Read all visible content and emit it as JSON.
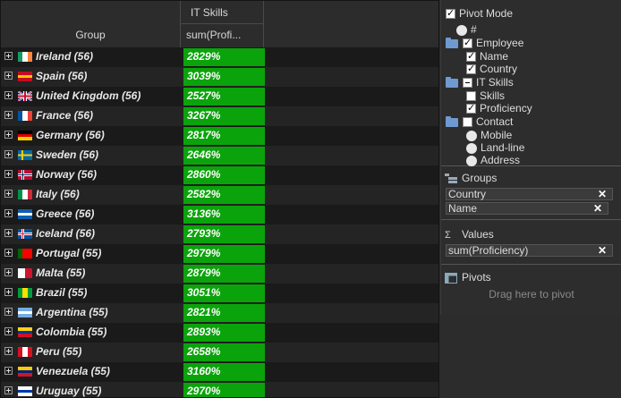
{
  "header": {
    "group_col": "Group",
    "itskills_col": "IT Skills",
    "sum_col": "sum(Profi..."
  },
  "rows": [
    {
      "label": "Ireland (56)",
      "value": "2829%",
      "flag": "ireland-flag-icon",
      "flag_colors": [
        "#169b62",
        "#ffffff",
        "#ff883e"
      ],
      "flag_dir": "v"
    },
    {
      "label": "Spain (56)",
      "value": "3039%",
      "flag": "spain-flag-icon",
      "flag_colors": [
        "#c60b1e",
        "#ffc400",
        "#c60b1e"
      ],
      "flag_dir": "h"
    },
    {
      "label": "United Kingdom (56)",
      "value": "2527%",
      "flag": "uk-flag-icon",
      "flag_colors": [
        "#012169",
        "#c8102e",
        "#ffffff"
      ],
      "flag_dir": "uk"
    },
    {
      "label": "France (56)",
      "value": "3267%",
      "flag": "france-flag-icon",
      "flag_colors": [
        "#0055a4",
        "#ffffff",
        "#ef4135"
      ],
      "flag_dir": "v"
    },
    {
      "label": "Germany (56)",
      "value": "2817%",
      "flag": "germany-flag-icon",
      "flag_colors": [
        "#000000",
        "#dd0000",
        "#ffce00"
      ],
      "flag_dir": "h"
    },
    {
      "label": "Sweden (56)",
      "value": "2646%",
      "flag": "sweden-flag-icon",
      "flag_colors": [
        "#006aa7",
        "#fecc00"
      ],
      "flag_dir": "nordic"
    },
    {
      "label": "Norway (56)",
      "value": "2860%",
      "flag": "norway-flag-icon",
      "flag_colors": [
        "#ba0c2f",
        "#00205b"
      ],
      "flag_dir": "nordic"
    },
    {
      "label": "Italy (56)",
      "value": "2582%",
      "flag": "italy-flag-icon",
      "flag_colors": [
        "#009246",
        "#ffffff",
        "#ce2b37"
      ],
      "flag_dir": "v"
    },
    {
      "label": "Greece (56)",
      "value": "3136%",
      "flag": "greece-flag-icon",
      "flag_colors": [
        "#0d5eaf",
        "#ffffff",
        "#0d5eaf"
      ],
      "flag_dir": "h"
    },
    {
      "label": "Iceland (56)",
      "value": "2793%",
      "flag": "iceland-flag-icon",
      "flag_colors": [
        "#02529c",
        "#dc1e35"
      ],
      "flag_dir": "nordic"
    },
    {
      "label": "Portugal (55)",
      "value": "2979%",
      "flag": "portugal-flag-icon",
      "flag_colors": [
        "#006600",
        "#ff0000",
        "#ff0000"
      ],
      "flag_dir": "v"
    },
    {
      "label": "Malta (55)",
      "value": "2879%",
      "flag": "malta-flag-icon",
      "flag_colors": [
        "#ffffff",
        "#cf142b"
      ],
      "flag_dir": "v"
    },
    {
      "label": "Brazil (55)",
      "value": "3051%",
      "flag": "brazil-flag-icon",
      "flag_colors": [
        "#009c3b",
        "#ffdf00",
        "#009c3b"
      ],
      "flag_dir": "v"
    },
    {
      "label": "Argentina (55)",
      "value": "2821%",
      "flag": "argentina-flag-icon",
      "flag_colors": [
        "#74acdf",
        "#ffffff",
        "#74acdf"
      ],
      "flag_dir": "h"
    },
    {
      "label": "Colombia (55)",
      "value": "2893%",
      "flag": "colombia-flag-icon",
      "flag_colors": [
        "#fcd116",
        "#003893",
        "#ce1126"
      ],
      "flag_dir": "h"
    },
    {
      "label": "Peru (55)",
      "value": "2658%",
      "flag": "peru-flag-icon",
      "flag_colors": [
        "#d91023",
        "#ffffff",
        "#d91023"
      ],
      "flag_dir": "v"
    },
    {
      "label": "Venezuela (55)",
      "value": "3160%",
      "flag": "venezuela-flag-icon",
      "flag_colors": [
        "#ffcc00",
        "#00247d",
        "#cf142b"
      ],
      "flag_dir": "h"
    },
    {
      "label": "Uruguay (55)",
      "value": "2970%",
      "flag": "uruguay-flag-icon",
      "flag_colors": [
        "#ffffff",
        "#0038a8",
        "#ffffff"
      ],
      "flag_dir": "h"
    }
  ],
  "panel": {
    "pivot_mode": "Pivot Mode",
    "columns_tree": {
      "hash": "#",
      "employee": "Employee",
      "name": "Name",
      "country": "Country",
      "itskills": "IT Skills",
      "skills": "Skills",
      "proficiency": "Proficiency",
      "contact": "Contact",
      "mobile": "Mobile",
      "landline": "Land-line",
      "address": "Address"
    },
    "groups_title": "Groups",
    "groups": [
      "Country",
      "Name"
    ],
    "values_title": "Values",
    "values": [
      "sum(Proficiency)"
    ],
    "pivots_title": "Pivots",
    "pivots_hint": "Drag here to pivot",
    "remove_glyph": "✕"
  },
  "colors": {
    "value_green": "#0ba30b",
    "row_even": "#1a1a1a",
    "row_odd": "#242424"
  }
}
